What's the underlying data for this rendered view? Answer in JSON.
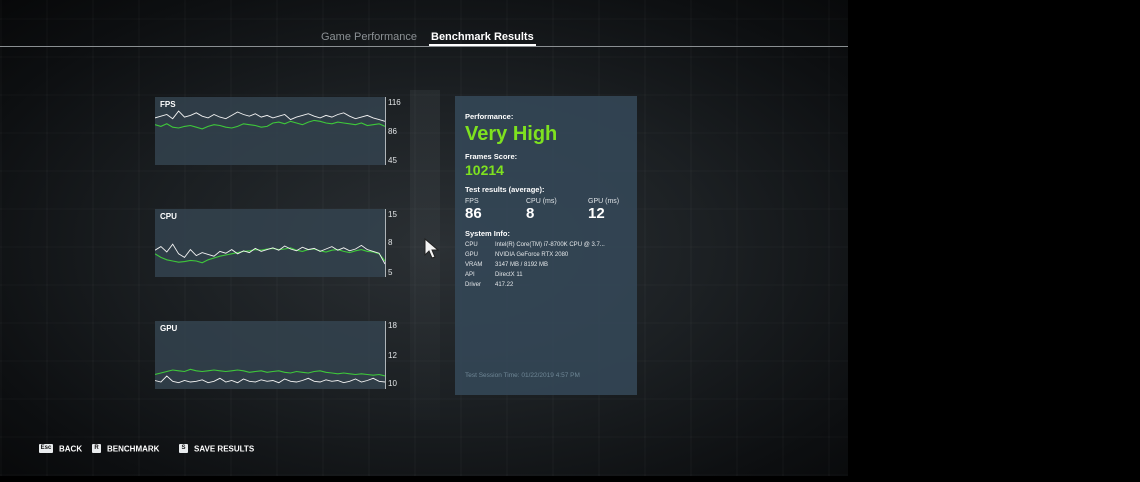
{
  "tabs": [
    {
      "label": "Game Performance",
      "active": false
    },
    {
      "label": "Benchmark Results",
      "active": true
    }
  ],
  "graphs": [
    {
      "label": "FPS",
      "ticks": [
        "116",
        "86",
        "45"
      ],
      "ymin": 45,
      "ymax": 116,
      "white": [
        96,
        98,
        100,
        95,
        104,
        97,
        99,
        102,
        98,
        96,
        100,
        97,
        95,
        99,
        103,
        100,
        98,
        101,
        97,
        99,
        96,
        98,
        100,
        94,
        97,
        99,
        101,
        98,
        96,
        99,
        97,
        100,
        102,
        98,
        95,
        97,
        99,
        96,
        94,
        92
      ],
      "green": [
        88,
        86,
        89,
        85,
        84,
        86,
        87,
        85,
        83,
        86,
        88,
        87,
        85,
        84,
        86,
        89,
        88,
        87,
        85,
        86,
        90,
        91,
        89,
        92,
        90,
        88,
        91,
        93,
        92,
        90,
        89,
        91,
        90,
        89,
        88,
        90,
        87,
        88,
        89,
        86
      ]
    },
    {
      "label": "CPU",
      "ticks": [
        "15",
        "8",
        "5"
      ],
      "ymin": 5,
      "ymax": 15,
      "white": [
        8.8,
        9.4,
        8.5,
        9.8,
        8.2,
        7.6,
        8.9,
        7.9,
        8.4,
        8.1,
        7.8,
        8.6,
        8.3,
        8.9,
        8.2,
        8.7,
        8.4,
        9.1,
        8.6,
        8.9,
        9.2,
        8.8,
        9.5,
        9.0,
        8.7,
        9.3,
        8.9,
        9.1,
        8.6,
        9.0,
        9.4,
        8.8,
        9.2,
        8.7,
        9.0,
        9.6,
        8.9,
        8.6,
        8.3,
        6.5
      ],
      "green": [
        8.2,
        7.6,
        7.2,
        7.0,
        6.8,
        6.9,
        7.1,
        7.0,
        6.7,
        7.2,
        7.5,
        7.8,
        8.0,
        8.2,
        8.4,
        8.6,
        8.7,
        8.9,
        8.8,
        9.0,
        9.1,
        8.9,
        9.0,
        9.2,
        8.8,
        8.6,
        8.9,
        9.0,
        8.7,
        8.5,
        8.8,
        8.9,
        8.6,
        8.4,
        8.7,
        8.9,
        8.6,
        8.5,
        8.2,
        7.0
      ]
    },
    {
      "label": "GPU",
      "ticks": [
        "18",
        "12",
        "10"
      ],
      "ymin": 10,
      "ymax": 18,
      "white": [
        10.6,
        10.4,
        11.2,
        10.5,
        10.3,
        10.6,
        10.4,
        10.5,
        10.7,
        10.3,
        10.5,
        10.9,
        10.4,
        10.6,
        10.3,
        10.8,
        10.5,
        10.4,
        10.7,
        10.5,
        10.6,
        10.3,
        10.8,
        10.5,
        10.4,
        10.6,
        10.9,
        10.5,
        10.4,
        10.7,
        10.5,
        10.6,
        10.3,
        10.5,
        10.8,
        10.4,
        10.6,
        10.9,
        10.5,
        10.4
      ],
      "green": [
        11.4,
        11.6,
        11.8,
        12.0,
        11.9,
        11.8,
        12.1,
        11.9,
        11.8,
        11.9,
        12.0,
        11.9,
        11.8,
        11.9,
        12.0,
        11.9,
        11.7,
        11.8,
        11.9,
        11.7,
        11.8,
        11.9,
        11.7,
        11.6,
        11.8,
        11.7,
        11.6,
        11.8,
        11.9,
        11.7,
        11.6,
        11.5,
        11.6,
        11.5,
        11.4,
        11.5,
        11.4,
        11.3,
        11.4,
        11.2
      ]
    }
  ],
  "colors": {
    "accent_green": "#7ee21f",
    "line_white": "#f2f2f2",
    "line_green": "#3ec83a",
    "panel_bg": "#344858"
  },
  "panel": {
    "performance_label": "Performance:",
    "performance_value": "Very High",
    "frames_score_label": "Frames Score:",
    "frames_score_value": "10214",
    "test_results_label": "Test results (average):",
    "stats": [
      {
        "name": "FPS",
        "value": "86"
      },
      {
        "name": "CPU (ms)",
        "value": "8"
      },
      {
        "name": "GPU (ms)",
        "value": "12"
      }
    ],
    "system_info_label": "System Info:",
    "system_info": [
      {
        "key": "CPU",
        "value": "Intel(R) Core(TM) i7-8700K CPU @ 3.7..."
      },
      {
        "key": "GPU",
        "value": "NVIDIA GeForce RTX 2080"
      },
      {
        "key": "VRAM",
        "value": "3147 MB / 8192 MB"
      },
      {
        "key": "API",
        "value": "DirectX 11"
      },
      {
        "key": "Driver",
        "value": "417.22"
      }
    ],
    "session_time": "Test Session Time: 01/22/2019 4:57 PM"
  },
  "footer": {
    "back": {
      "key": "Esc",
      "label": "BACK"
    },
    "benchmark": {
      "key": "R",
      "label": "BENCHMARK"
    },
    "save": {
      "key": "S",
      "label": "SAVE RESULTS"
    }
  }
}
